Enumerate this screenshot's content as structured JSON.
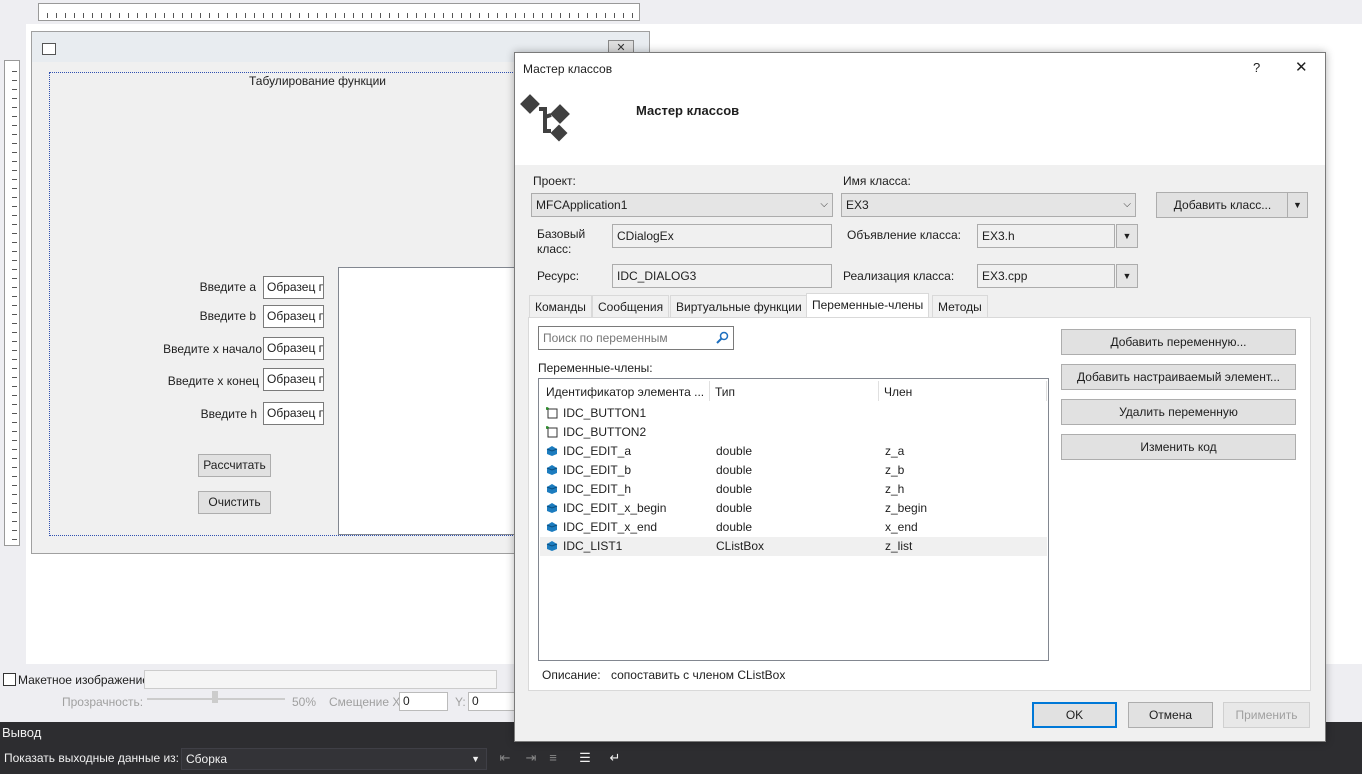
{
  "design": {
    "group_title": "Табулирование функции",
    "labels": {
      "a": "Введите а",
      "b": "Введите b",
      "x_start": "Введите х начало",
      "x_end": "Введите х конец",
      "h": "Введите h"
    },
    "edit_sample": "Образец п",
    "calc_button": "Рассчитать",
    "clear_button": "Очистить"
  },
  "mockup_bar": {
    "checkbox_label": "Макетное изображение:",
    "transparency_label": "Прозрачность:",
    "transparency_value": "50%",
    "offset_x_label": "Смещение X:",
    "offset_x_value": "0",
    "offset_y_label": "Y:",
    "offset_y_value": "0"
  },
  "output": {
    "title": "Вывод",
    "show_label": "Показать выходные данные из:",
    "source": "Сборка"
  },
  "wizard": {
    "title": "Мастер классов",
    "help": "?",
    "close": "✕",
    "header_title": "Мастер классов",
    "project_label": "Проект:",
    "project_value": "MFCApplication1",
    "class_name_label": "Имя класса:",
    "class_name_value": "EX3",
    "add_class_button": "Добавить класс...",
    "base_class_label": "Базовый класс:",
    "base_class_value": "CDialogEx",
    "declaration_label": "Объявление класса:",
    "declaration_value": "EX3.h",
    "resource_label": "Ресурс:",
    "resource_value": "IDC_DIALOG3",
    "implementation_label": "Реализация класса:",
    "implementation_value": "EX3.cpp",
    "tabs": [
      "Команды",
      "Сообщения",
      "Виртуальные функции",
      "Переменные-члены",
      "Методы"
    ],
    "active_tab": "Переменные-члены",
    "search_placeholder": "Поиск по переменным",
    "members_label": "Переменные-члены:",
    "columns": [
      "Идентификатор элемента ...",
      "Тип",
      "Член"
    ],
    "rows": [
      {
        "id": "IDC_BUTTON1",
        "type": "",
        "member": "",
        "icon": "button-control-icon"
      },
      {
        "id": "IDC_BUTTON2",
        "type": "",
        "member": "",
        "icon": "button-control-icon"
      },
      {
        "id": "IDC_EDIT_a",
        "type": "double",
        "member": "z_a",
        "icon": "variable-icon"
      },
      {
        "id": "IDC_EDIT_b",
        "type": "double",
        "member": "z_b",
        "icon": "variable-icon"
      },
      {
        "id": "IDC_EDIT_h",
        "type": "double",
        "member": "z_h",
        "icon": "variable-icon"
      },
      {
        "id": "IDC_EDIT_x_begin",
        "type": "double",
        "member": "z_begin",
        "icon": "variable-icon"
      },
      {
        "id": "IDC_EDIT_x_end",
        "type": "double",
        "member": "x_end",
        "icon": "variable-icon"
      },
      {
        "id": "IDC_LIST1",
        "type": "CListBox",
        "member": "z_list",
        "icon": "variable-icon"
      }
    ],
    "selected_row": 7,
    "side_buttons": [
      "Добавить переменную...",
      "Добавить настраиваемый элемент...",
      "Удалить переменную",
      "Изменить код"
    ],
    "description_label": "Описание:",
    "description_value": "сопоставить с членом CListBox",
    "ok_button": "OK",
    "cancel_button": "Отмена",
    "apply_button": "Применить"
  }
}
